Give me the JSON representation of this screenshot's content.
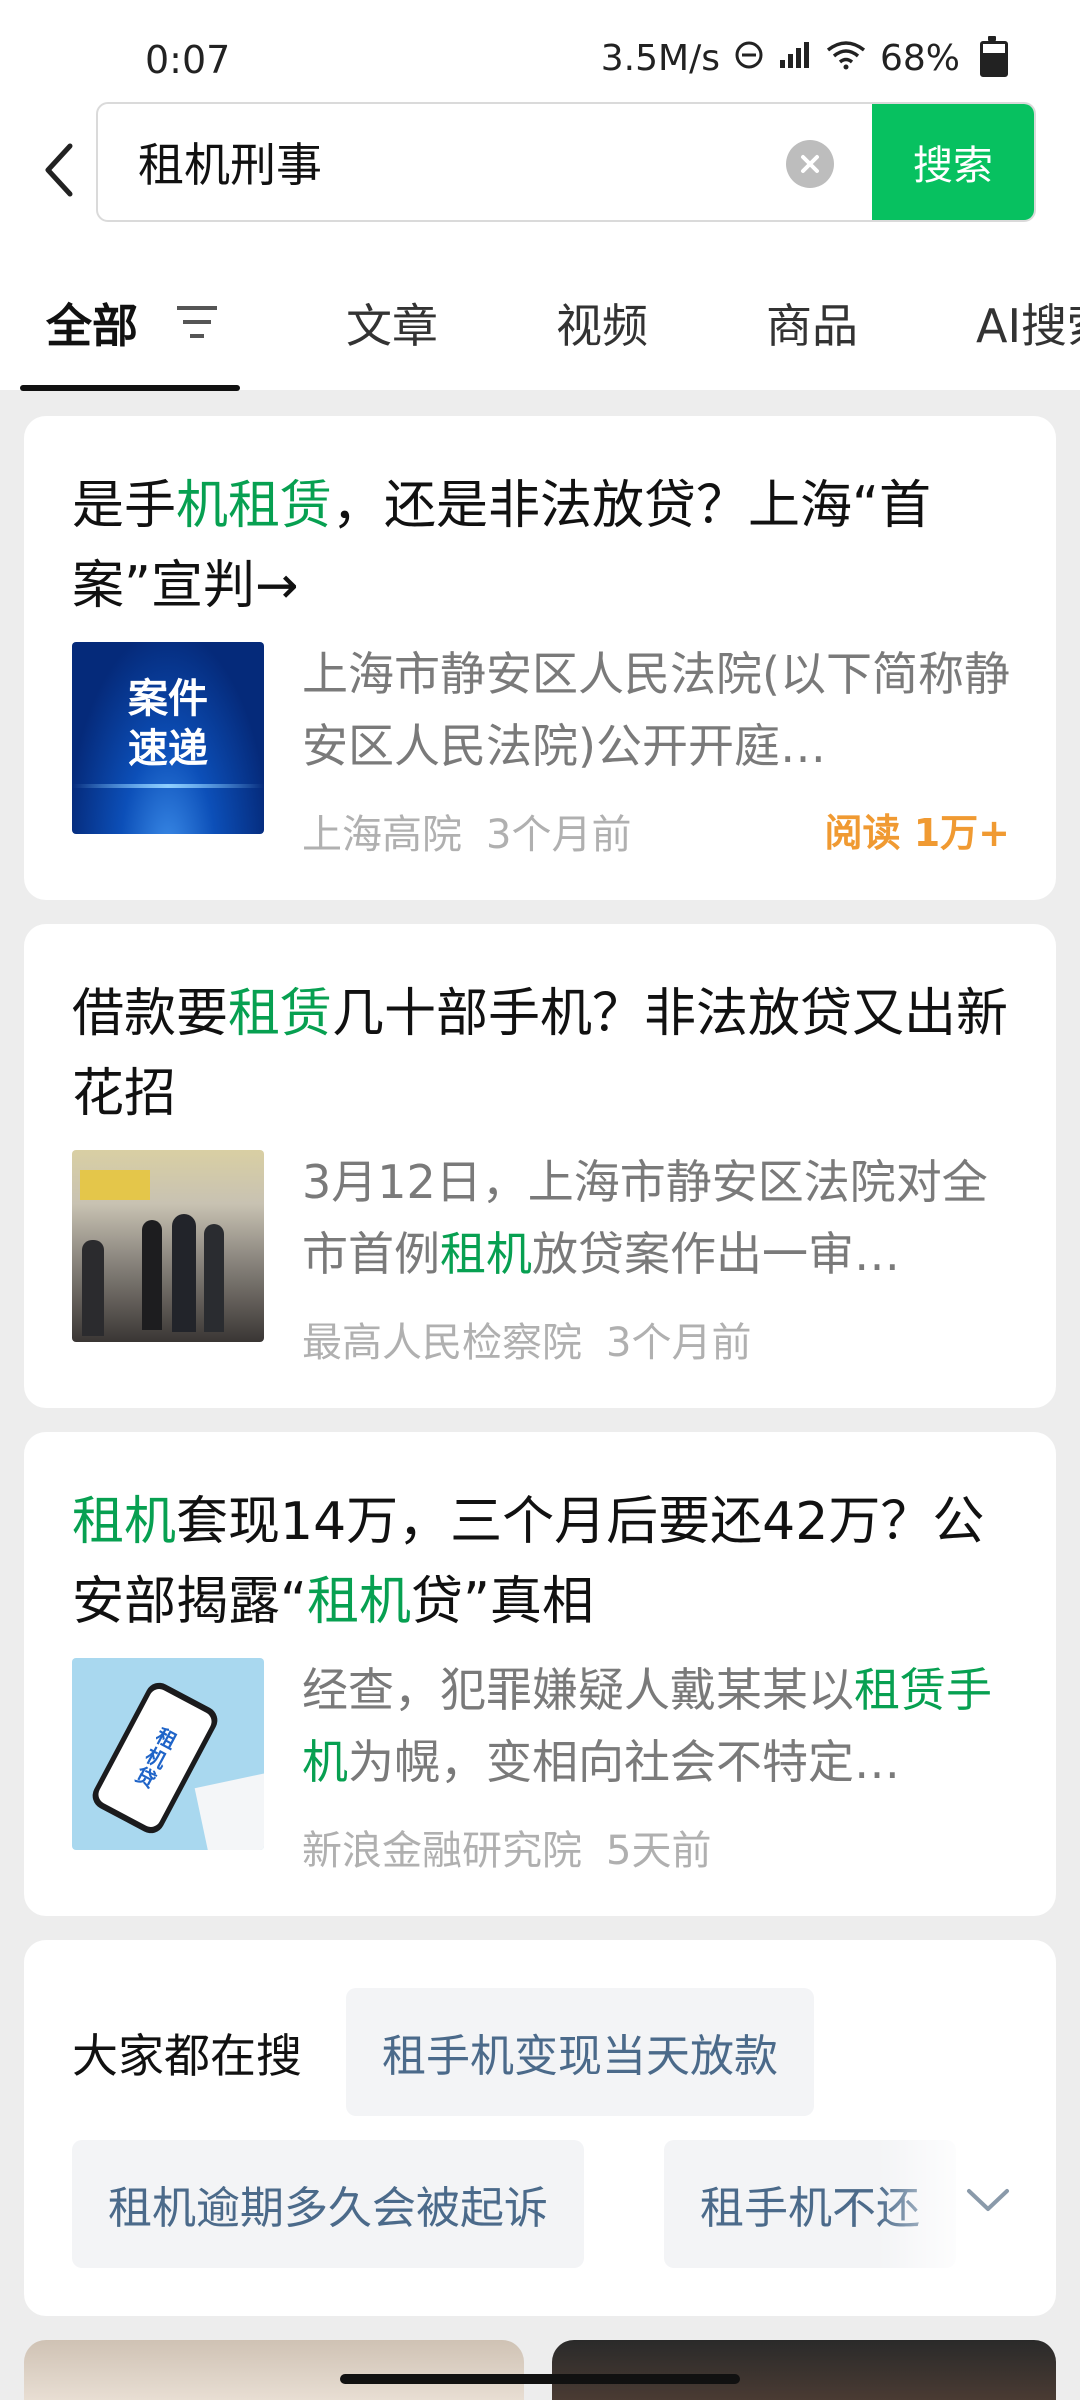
{
  "status_bar": {
    "time": "0:07",
    "network_speed": "3.5M/s",
    "battery_percent": "68%",
    "battery_level": 0.68
  },
  "search": {
    "query": "租机刑事",
    "button_label": "搜索"
  },
  "tabs": [
    {
      "label": "全部"
    },
    {
      "label": "文章"
    },
    {
      "label": "视频"
    },
    {
      "label": "商品"
    },
    {
      "label": "AI搜索"
    }
  ],
  "results": [
    {
      "title_parts": [
        "是手",
        "机租赁",
        "，还是非法放贷？上海“首案”宣判→"
      ],
      "snippet_parts": [
        "上海市静安区人民法院(以下简称静安区人民法院)公开开庭…"
      ],
      "thumb_text": [
        "案件",
        "速递"
      ],
      "source": "上海高院",
      "time": "3个月前",
      "reads": "阅读 1万+"
    },
    {
      "title_parts": [
        "借款要",
        "租赁",
        "几十部手机？非法放贷又出新花招"
      ],
      "snippet_parts": [
        "3月12日，上海市静安区法院对全市首例",
        "租机",
        "放贷案作出一审…"
      ],
      "source": "最高人民检察院",
      "time": "3个月前"
    },
    {
      "title_parts": [
        "租机",
        "套现14万，三个月后要还42万？公安部揭露“",
        "租机",
        "贷”真相"
      ],
      "snippet_parts": [
        "经查，犯罪嫌疑人戴某某以",
        "租赁手机",
        "为幌，变相向社会不特定…"
      ],
      "thumb_text": [
        "租机贷"
      ],
      "source": "新浪金融研究院",
      "time": "5天前"
    }
  ],
  "related": {
    "label": "大家都在搜",
    "chips": [
      "租手机变现当天放款",
      "租机逾期多久会被起诉",
      "租手机不还"
    ]
  },
  "colors": {
    "accent": "#07c160",
    "highlight": "#07a051",
    "reads": "#f09a32"
  }
}
